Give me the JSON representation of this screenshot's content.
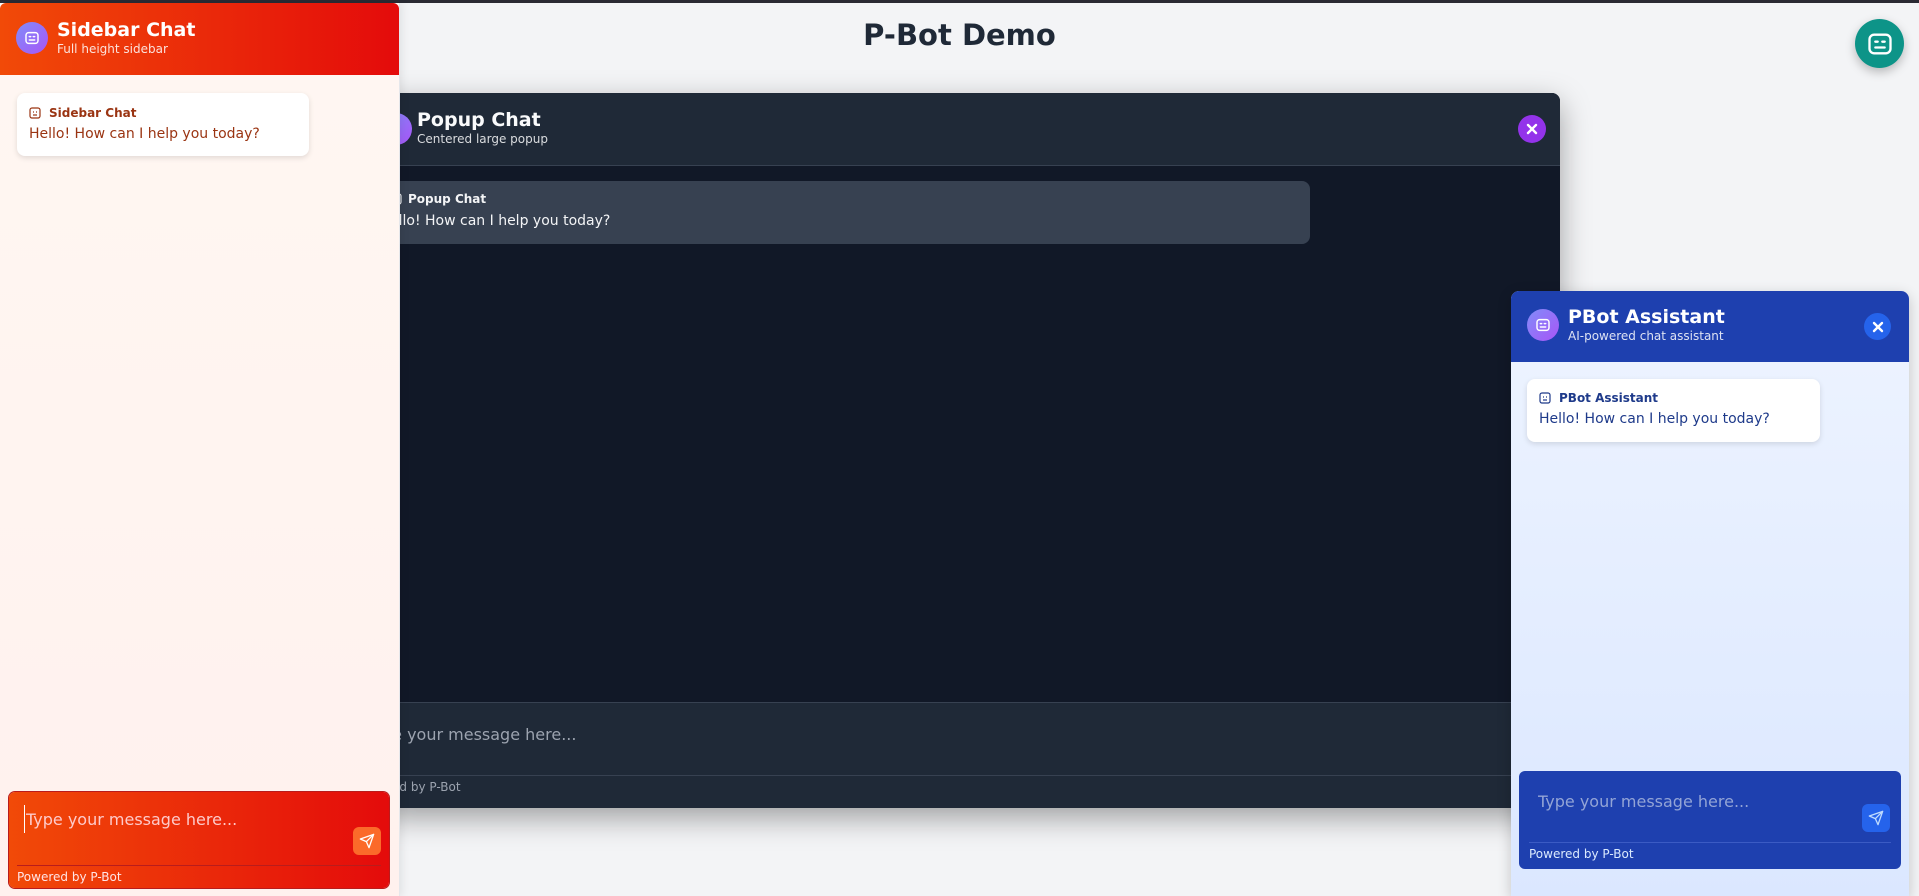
{
  "page": {
    "title": "P-Bot Demo"
  },
  "fab": {
    "icon": "bot-icon",
    "color": "#0d9488"
  },
  "popup": {
    "title": "Popup Chat",
    "subtitle": "Centered large popup",
    "message": {
      "sender": "Popup Chat",
      "text": "ello! How can I help you today?"
    },
    "input_placeholder": "pe your message here...",
    "powered": "ered by P-Bot",
    "accent": "#9333ea"
  },
  "sidebar": {
    "title": "Sidebar Chat",
    "subtitle": "Full height sidebar",
    "message": {
      "sender": "Sidebar Chat",
      "text": "Hello! How can I help you today?"
    },
    "input_placeholder": "Type your message here...",
    "powered": "Powered by P-Bot",
    "accent": "#e40b0b"
  },
  "widget": {
    "title": "PBot Assistant",
    "subtitle": "AI-powered chat assistant",
    "message": {
      "sender": "PBot Assistant",
      "text": "Hello! How can I help you today?"
    },
    "input_placeholder": "Type your message here...",
    "powered": "Powered by P-Bot",
    "accent": "#1e40af"
  }
}
